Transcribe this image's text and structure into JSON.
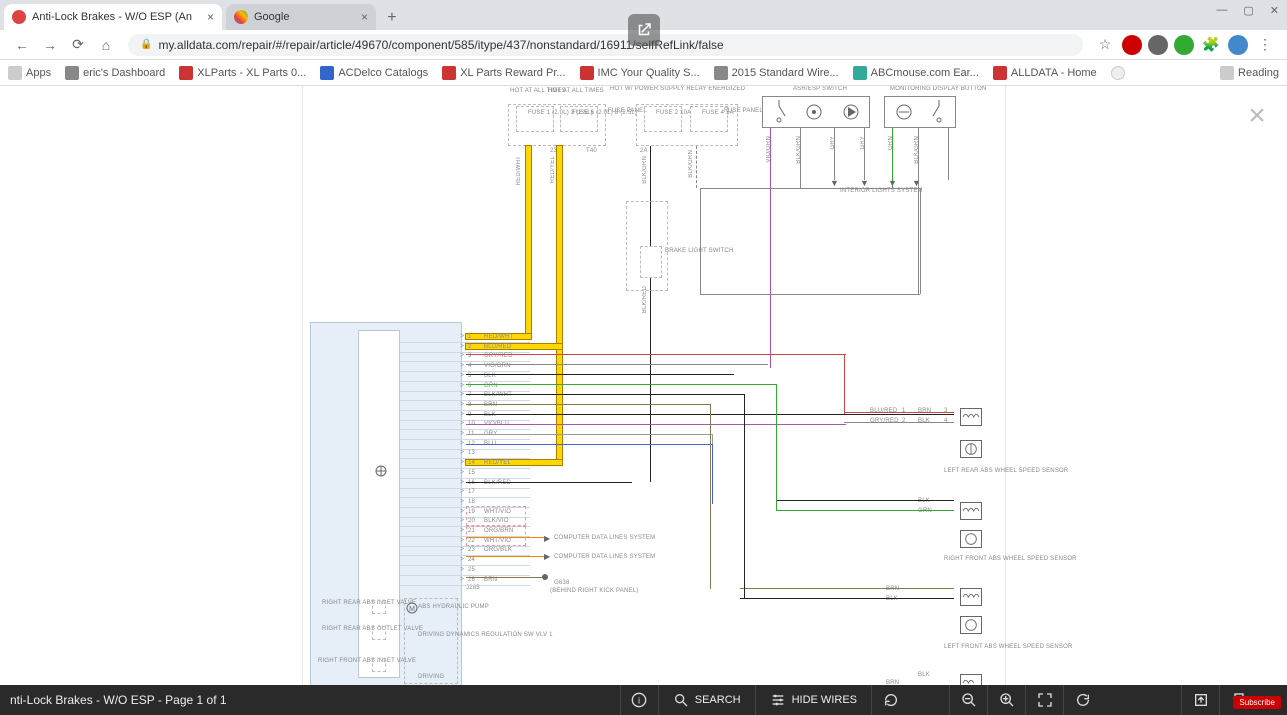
{
  "browser": {
    "tabs": [
      {
        "label": "Anti-Lock Brakes - W/O ESP (An",
        "active": true
      },
      {
        "label": "Google",
        "active": false
      }
    ],
    "url": "my.alldata.com/repair/#/repair/article/49670/component/585/itype/437/nonstandard/16911/selfRefLink/false",
    "bookmarks": [
      {
        "label": "Apps"
      },
      {
        "label": "eric's Dashboard"
      },
      {
        "label": "XLParts - XL Parts 0..."
      },
      {
        "label": "ACDelco Catalogs"
      },
      {
        "label": "XL Parts Reward Pr..."
      },
      {
        "label": "IMC Your Quality S..."
      },
      {
        "label": "2015 Standard Wire..."
      },
      {
        "label": "ABCmouse.com Ear..."
      },
      {
        "label": "ALLDATA - Home"
      }
    ],
    "reading": "Reading"
  },
  "diagram": {
    "top_labels": {
      "hot1": "HOT AT ALL TIMES",
      "hot2": "HOT AT ALL TIMES",
      "hot3": "HOT W/ POWER SUPPLY RELAY ENERGIZED",
      "fuse_panel": "FUSE PANEL",
      "fuse1": "FUSE 1 (2.0L) 3 (2.5L)",
      "fuse2": "FUSE 6 (2.0L) 8 (2.5L)",
      "fuse3": "FUSE 2 10A",
      "fuse4": "FUSE 4 5A",
      "asr": "ASR/ESP SWITCH",
      "monitor": "MONITORING DISPLAY BUTTON",
      "interior": "INTERIOR LIGHTS SYSTEM",
      "brake": "BRAKE LIGHT SWITCH",
      "t40": "T40",
      "j23": "23",
      "j2a": "2A"
    },
    "pins": [
      {
        "n": "1",
        "c": "RED/WHT"
      },
      {
        "n": "2",
        "c": "BLU/RED"
      },
      {
        "n": "3",
        "c": "GRY/RED"
      },
      {
        "n": "4",
        "c": "VIO/GRN"
      },
      {
        "n": "5",
        "c": "BLK"
      },
      {
        "n": "6",
        "c": "GRN"
      },
      {
        "n": "7",
        "c": "BLK/WHT"
      },
      {
        "n": "8",
        "c": "BRN"
      },
      {
        "n": "9",
        "c": "BLK"
      },
      {
        "n": "10",
        "c": "VIO/BLU"
      },
      {
        "n": "11",
        "c": "GRY"
      },
      {
        "n": "12",
        "c": "BLU"
      },
      {
        "n": "13",
        "c": ""
      },
      {
        "n": "14",
        "c": "RED/YEL"
      },
      {
        "n": "15",
        "c": ""
      },
      {
        "n": "16",
        "c": "BLK/RED"
      },
      {
        "n": "17",
        "c": ""
      },
      {
        "n": "18",
        "c": ""
      },
      {
        "n": "19",
        "c": "WHT/VIO"
      },
      {
        "n": "20",
        "c": "BLK/VIO"
      },
      {
        "n": "21",
        "c": "ORG/BRN"
      },
      {
        "n": "22",
        "c": "WHT/VIO"
      },
      {
        "n": "23",
        "c": "ORG/BLK"
      },
      {
        "n": "24",
        "c": ""
      },
      {
        "n": "25",
        "c": ""
      },
      {
        "n": "26",
        "c": "BRN"
      }
    ],
    "adj_pins": {
      "a": "BLU/RED",
      "b": "GRY/RED",
      "c": "BRN",
      "d": "BLK",
      "n1": "1",
      "n2": "2",
      "n3": "3",
      "n4": "4"
    },
    "data_lines": "COMPUTER DATA LINES SYSTEM",
    "ground": "(BEHIND RIGHT KICK PANEL)",
    "ground_id": "G638",
    "conn_j": "J285",
    "module_labels": {
      "rr_in": "RIGHT REAR ABS INLET VALVE",
      "rr_out": "RIGHT REAR ABS OUTLET VALVE",
      "rf_in": "RIGHT FRONT ABS INLET VALVE",
      "pump": "ABS HYDRAULIC PUMP",
      "dynamics": "DRIVING DYNAMICS REGULATION SW VLV 1",
      "driving": "DRIVING"
    },
    "sensors": {
      "lr": "LEFT REAR ABS WHEEL SPEED SENSOR",
      "rf": "RIGHT FRONT ABS WHEEL SPEED SENSOR",
      "lf": "LEFT FRONT ABS WHEEL SPEED SENSOR"
    },
    "sensor_pins": {
      "brn": "BRN",
      "blk": "BLK",
      "grn": "GRN"
    }
  },
  "footer": {
    "title": "nti-Lock Brakes - W/O ESP - Page 1 of 1",
    "search": "SEARCH",
    "hide": "HIDE WIRES"
  },
  "yt": "Subscribe"
}
